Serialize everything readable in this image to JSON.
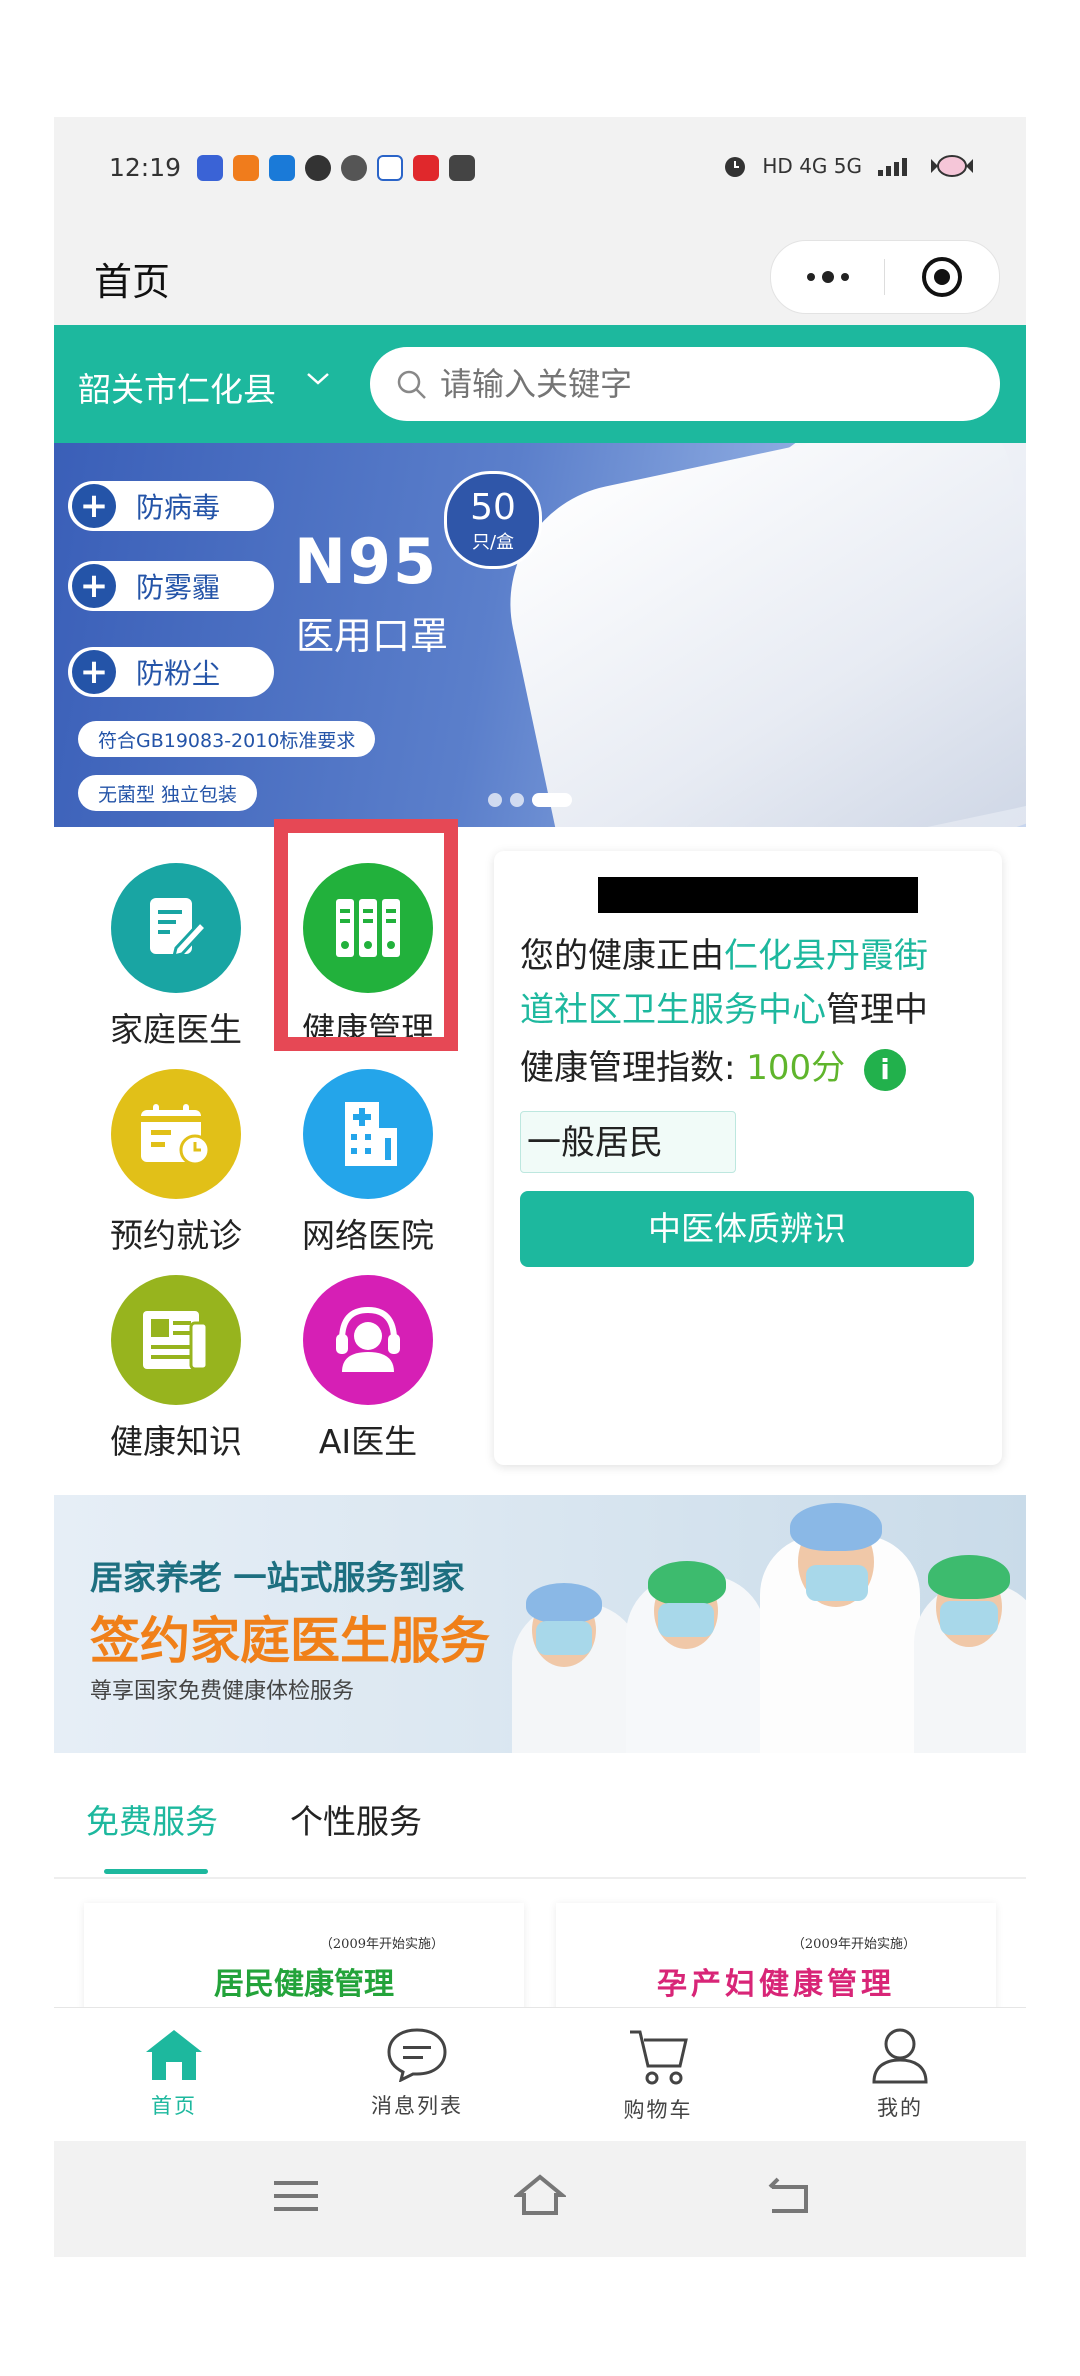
{
  "status_bar": {
    "time": "12:19",
    "network": "HD 4G 5G"
  },
  "header": {
    "title": "首页"
  },
  "location": {
    "city": "韶关市仁化县"
  },
  "search": {
    "placeholder": "请输入关键字"
  },
  "banner": {
    "features": [
      "防病毒",
      "防雾霾",
      "防粉尘"
    ],
    "product": "N95",
    "product_sub": "医用口罩",
    "badge_number": "50",
    "badge_unit": "只/盒",
    "standard": "符合GB19083-2010标准要求",
    "packaging": "无菌型 独立包装"
  },
  "grid": [
    {
      "label": "家庭医生",
      "color": "#19a5a3",
      "icon": "document-edit-icon"
    },
    {
      "label": "健康管理",
      "color": "#22b13c",
      "icon": "binders-icon"
    },
    {
      "label": "预约就诊",
      "color": "#e1c018",
      "icon": "calendar-clock-icon"
    },
    {
      "label": "网络医院",
      "color": "#24a5ea",
      "icon": "hospital-icon"
    },
    {
      "label": "健康知识",
      "color": "#97b41e",
      "icon": "newspaper-icon"
    },
    {
      "label": "AI医生",
      "color": "#d61fb5",
      "icon": "headset-doctor-icon"
    }
  ],
  "health_card": {
    "line1_prefix": "您的健康正由",
    "center_part1": "仁化县丹霞街",
    "center_part2": "道社区卫生服务中心",
    "line2_suffix": "管理中",
    "index_label": "健康管理指数:",
    "index_value": "100分",
    "resident_type": "一般居民",
    "tcm_button": "中医体质辨识"
  },
  "promo": {
    "line1": "居家养老  一站式服务到家",
    "line2": "签约家庭医生服务",
    "line3": "尊享国家免费健康体检服务"
  },
  "tabs": [
    {
      "label": "免费服务"
    },
    {
      "label": "个性服务"
    }
  ],
  "services": [
    {
      "year_note": "（2009年开始实施）",
      "title": "居民健康管理",
      "color": "#23a33a"
    },
    {
      "year_note": "（2009年开始实施）",
      "title": "孕产妇健康管理",
      "color": "#d82577"
    }
  ],
  "bottom_nav": [
    {
      "label": "首页",
      "icon": "home-icon",
      "active": true
    },
    {
      "label": "消息列表",
      "icon": "chat-bubble-icon",
      "active": false
    },
    {
      "label": "购物车",
      "icon": "cart-icon",
      "active": false
    },
    {
      "label": "我的",
      "icon": "user-icon",
      "active": false
    }
  ],
  "colors": {
    "accent": "#1db89e",
    "highlight_box": "#e64855"
  }
}
